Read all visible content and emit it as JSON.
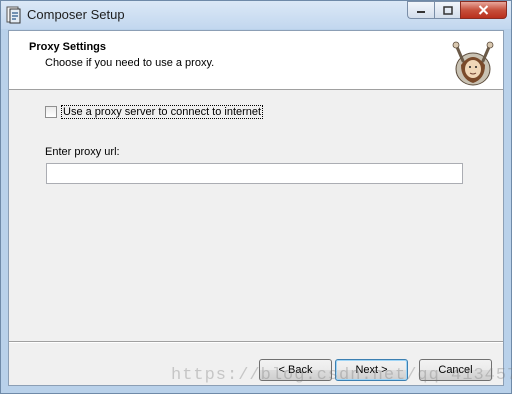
{
  "window": {
    "title": "Composer Setup",
    "controls": {
      "minimize": "minimize",
      "maximize": "maximize",
      "close": "close"
    }
  },
  "header": {
    "title": "Proxy Settings",
    "subtitle": "Choose if you need to use a proxy."
  },
  "proxy": {
    "checkbox_label": "Use a proxy server to connect to internet",
    "checked": false,
    "url_label": "Enter proxy url:",
    "url_value": ""
  },
  "buttons": {
    "back": "< Back",
    "next": "Next >",
    "cancel": "Cancel"
  },
  "watermark": "https://blog.csdn.net/qq_41345776",
  "colors": {
    "accent": "#3c7fb1",
    "close": "#c7503c"
  }
}
